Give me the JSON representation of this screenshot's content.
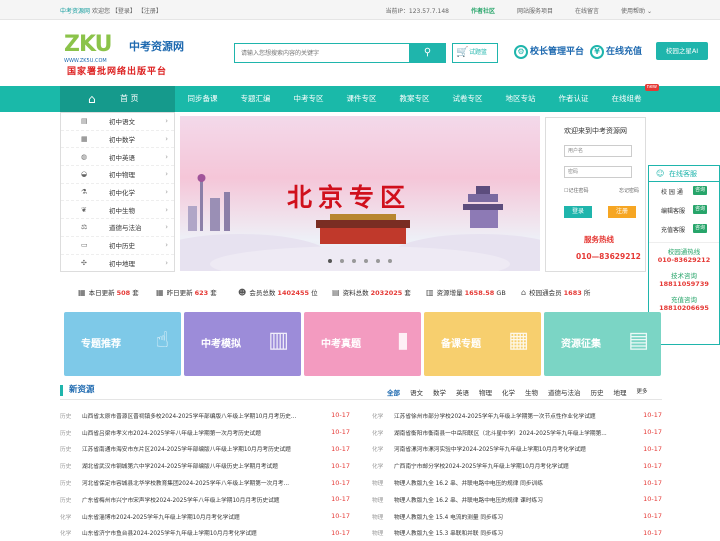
{
  "topbar": {
    "site": "中考资源网",
    "welcome": "欢迎您",
    "login": "【登录】",
    "register": "【注册】",
    "ip": "当前IP：123.57.7.148",
    "community": "作者社区",
    "network": "网站服务项目",
    "message": "在线留言",
    "help": "使用帮助"
  },
  "header": {
    "logo_mark": "ZKU",
    "logo_name": "中考资源网",
    "logo_url": "WWW.ZK5U.COM",
    "slogan": "国家署批网络出版平台",
    "search_placeholder": "请输入您想搜索内容的关键字",
    "basket": "试题篮",
    "principal": "校长管理平台",
    "recharge": "在线充值",
    "ai": "校园之星AI"
  },
  "nav": {
    "home": "首  页",
    "items": [
      "同步备课",
      "专题汇编",
      "中考专区",
      "课件专区",
      "教案专区",
      "试卷专区",
      "地区专站",
      "作者认证",
      "在线组卷"
    ],
    "new_badge": "new"
  },
  "categories": [
    {
      "label": "初中语文",
      "icon": "book-icon"
    },
    {
      "label": "初中数学",
      "icon": "calculator-icon"
    },
    {
      "label": "初中英语",
      "icon": "globe-icon"
    },
    {
      "label": "初中物理",
      "icon": "magnet-icon"
    },
    {
      "label": "初中化学",
      "icon": "flask-icon"
    },
    {
      "label": "初中生物",
      "icon": "leaf-icon"
    },
    {
      "label": "道德与法治",
      "icon": "scale-icon"
    },
    {
      "label": "初中历史",
      "icon": "scroll-icon"
    },
    {
      "label": "初中地理",
      "icon": "compass-icon"
    }
  ],
  "banner": {
    "title": "北京专区",
    "slide_count": 6,
    "active_slide": 1
  },
  "login": {
    "heading": "欢迎来到中考资源网",
    "user_placeholder": "用户名",
    "pass_placeholder": "密码",
    "remember": "记住密码",
    "forgot": "忘记密码",
    "login_btn": "登录",
    "register_btn": "注册",
    "hotline_label": "服务热线",
    "hotline": "010—83629212"
  },
  "kefu": {
    "title": "在线客服",
    "rows": [
      {
        "label": "校 园 通",
        "tag": "咨询"
      },
      {
        "label": "编辑客服",
        "tag": "咨询"
      },
      {
        "label": "充值客服",
        "tag": "咨询"
      }
    ],
    "hotline_label": "校园通热线",
    "hotline": "010-83629212",
    "tech_label": "技术咨询",
    "tech": "18811059739",
    "charge_label": "充值咨询",
    "charge": "18810206695"
  },
  "stats": [
    {
      "prefix": "本日更新",
      "value": "508",
      "unit": "套"
    },
    {
      "prefix": "昨日更新",
      "value": "623",
      "unit": "套"
    },
    {
      "prefix": "会员总数",
      "value": "1402455",
      "unit": "位"
    },
    {
      "prefix": "资料总数",
      "value": "2032025",
      "unit": "套"
    },
    {
      "prefix": "资源增量",
      "value": "1658.58",
      "unit": "GB"
    },
    {
      "prefix": "校园通会员",
      "value": "1683",
      "unit": "所"
    }
  ],
  "cards": [
    {
      "label": "专题推荐",
      "color": "#7ec9e8"
    },
    {
      "label": "中考模拟",
      "color": "#9c8cd9"
    },
    {
      "label": "中考真题",
      "color": "#f39bc0"
    },
    {
      "label": "备课专题",
      "color": "#f7cf6e"
    },
    {
      "label": "资源征集",
      "color": "#7bd5c5"
    }
  ],
  "news": {
    "title": "新资源",
    "tabs": [
      "全部",
      "语文",
      "数学",
      "英语",
      "物理",
      "化学",
      "生物",
      "道德与法治",
      "历史",
      "地理",
      "更多"
    ],
    "left": [
      {
        "sub": "历史",
        "title": "山西省太原市晋源区晋祠镇多校2024-2025学年部编版八年级上学期10月月考历史...",
        "date": "10-17"
      },
      {
        "sub": "历史",
        "title": "山西省吕梁市孝义市2024-2025学年八年级上学期第一次月考历史试题",
        "date": "10-17"
      },
      {
        "sub": "历史",
        "title": "江苏省南通市海安市东片区2024-2025学年部编版八年级上学期10月月考历史试题",
        "date": "10-17"
      },
      {
        "sub": "历史",
        "title": "湖北省武汉市钢城第六中学2024-2025学年部编版八年级历史上学期月考试题",
        "date": "10-17"
      },
      {
        "sub": "历史",
        "title": "河北省保定市容城县北华学校教育集团2024-2025学年八年级上学期第一次月考...",
        "date": "10-17"
      },
      {
        "sub": "历史",
        "title": "广东省梅州市兴宁市宋声学校2024-2025学年八年级上学期10月月考历史试题",
        "date": "10-17"
      },
      {
        "sub": "化学",
        "title": "山东省淄博市2024-2025学年九年级上学期10月月考化学试题",
        "date": "10-17"
      },
      {
        "sub": "化学",
        "title": "山东省济宁市鱼台县2024-2025学年九年级上学期10月月考化学试题",
        "date": "10-17"
      }
    ],
    "right": [
      {
        "sub": "化学",
        "title": "江苏省徐州市部分学校2024-2025学年九年级上学期第一次节点性作业化学试题",
        "date": "10-17"
      },
      {
        "sub": "化学",
        "title": "湖南省衡阳市衡南县一中岳阳联区（北斗星中学）2024-2025学年九年级上学期第...",
        "date": "10-17"
      },
      {
        "sub": "化学",
        "title": "河南省漯河市漯河实验中学2024-2025学年九年级上学期10月月考化学试题",
        "date": "10-17"
      },
      {
        "sub": "化学",
        "title": "广西南宁市邮分学校2024-2025学年九年级上学期10月月考化学试题",
        "date": "10-17"
      },
      {
        "sub": "物理",
        "title": "物理人教版九全 16.2 串、并联电路中电压的规律 同步训练",
        "date": "10-17"
      },
      {
        "sub": "物理",
        "title": "物理人教版九全 16.2 串、并联电路中电压的规律 课时练习",
        "date": "10-17"
      },
      {
        "sub": "物理",
        "title": "物理人教版九全 15.4 电流的测量 同步练习",
        "date": "10-17"
      },
      {
        "sub": "物理",
        "title": "物理人教版九全 15.3 串联和并联 同步练习",
        "date": "10-17"
      }
    ]
  }
}
